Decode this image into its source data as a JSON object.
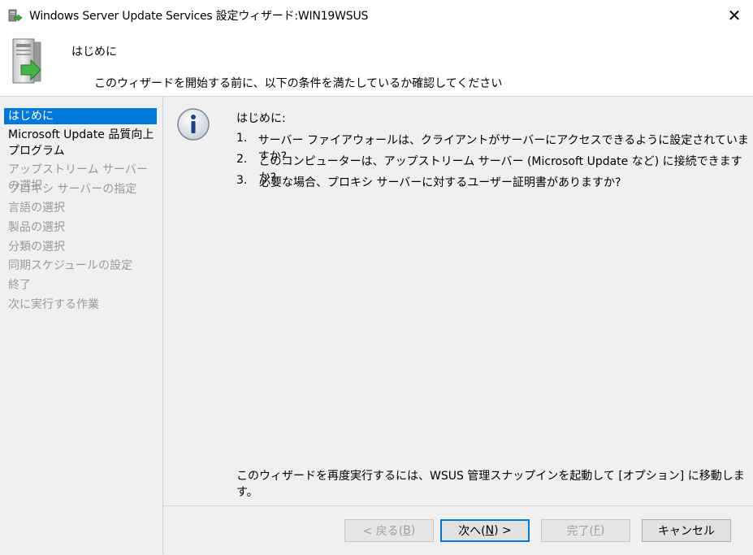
{
  "window": {
    "title": "Windows Server Update Services 設定ウィザード:WIN19WSUS",
    "close_glyph": "✕"
  },
  "header": {
    "title": "はじめに",
    "subtitle": "このウィザードを開始する前に、以下の条件を満たしているか確認してください"
  },
  "sidebar": {
    "items": [
      {
        "label": "はじめに",
        "state": "selected"
      },
      {
        "label": "Microsoft Update 品質向上\nプログラム",
        "state": "active"
      },
      {
        "label": "アップストリーム サーバーの選択",
        "state": "disabled"
      },
      {
        "label": "プロキシ サーバーの指定",
        "state": "disabled"
      },
      {
        "label": "言語の選択",
        "state": "disabled"
      },
      {
        "label": "製品の選択",
        "state": "disabled"
      },
      {
        "label": "分類の選択",
        "state": "disabled"
      },
      {
        "label": "同期スケジュールの設定",
        "state": "disabled"
      },
      {
        "label": "終了",
        "state": "disabled"
      },
      {
        "label": "次に実行する作業",
        "state": "disabled"
      }
    ]
  },
  "content": {
    "intro_label": "はじめに:",
    "items": [
      {
        "num": "1.",
        "text": "サーバー ファイアウォールは、クライアントがサーバーにアクセスできるように設定されていますか?"
      },
      {
        "num": "2.",
        "text": "このコンピューターは、アップストリーム サーバー (Microsoft Update など) に接続できますか?"
      },
      {
        "num": "3.",
        "text": "必要な場合、プロキシ サーバーに対するユーザー証明書がありますか?"
      }
    ],
    "footer_note": "このウィザードを再度実行するには、WSUS 管理スナップインを起動して [オプション] に移動します。"
  },
  "buttons": {
    "back": {
      "pre": "< 戻る(",
      "key": "B",
      "post": ")",
      "enabled": false
    },
    "next": {
      "pre": "次へ(",
      "key": "N",
      "post": ") >",
      "enabled": true
    },
    "finish": {
      "pre": "完了(",
      "key": "F",
      "post": ")",
      "enabled": false
    },
    "cancel": {
      "label": "キャンセル",
      "enabled": true
    }
  },
  "colors": {
    "selection": "#0078d7",
    "disabled_text": "#9a9a9a"
  },
  "icons": {
    "title": "wsus-server-icon",
    "header": "server-arrow-icon",
    "info": "info-icon"
  }
}
